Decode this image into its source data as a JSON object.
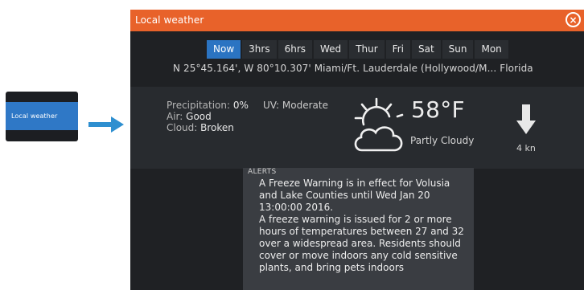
{
  "callout": {
    "menu_item_label": "Local weather"
  },
  "panel": {
    "title": "Local weather",
    "close_glyph": "×",
    "tabs": [
      {
        "label": "Now",
        "active": true
      },
      {
        "label": "3hrs",
        "active": false
      },
      {
        "label": "6hrs",
        "active": false
      },
      {
        "label": "Wed",
        "active": false
      },
      {
        "label": "Thur",
        "active": false
      },
      {
        "label": "Fri",
        "active": false
      },
      {
        "label": "Sat",
        "active": false
      },
      {
        "label": "Sun",
        "active": false
      },
      {
        "label": "Mon",
        "active": false
      }
    ],
    "location": "N  25°45.164', W  80°10.307' Miami/Ft. Lauderdale (Hollywood/M... Florida",
    "current": {
      "precipitation_label": "Precipitation:",
      "precipitation_value": "0%",
      "air_label": "Air:",
      "air_value": "Good",
      "cloud_label": "Cloud:",
      "cloud_value": "Broken",
      "uv_label": "UV:",
      "uv_value": "Moderate",
      "temperature": "58°F",
      "condition": "Partly Cloudy",
      "condition_icon": "partly-cloudy-icon",
      "wind_icon": "wind-direction-arrow-icon",
      "wind_speed": "4 kn"
    },
    "alerts": {
      "heading": "ALERTS",
      "text": "A Freeze Warning is in effect for Volusia and Lake Counties until Wed Jan 20 13:00:00 2016.\nA freeze warning is issued for 2 or more hours of temperatures between 27 and 32 over a widespread area. Residents should cover or move indoors any cold sensitive plants, and bring pets indoors"
    }
  },
  "colors": {
    "titlebar": "#e8622a",
    "active_tab": "#2b74c2",
    "menu_item": "#2f78c6",
    "arrow": "#2e8fd0",
    "panel_bg": "#1f2124"
  }
}
